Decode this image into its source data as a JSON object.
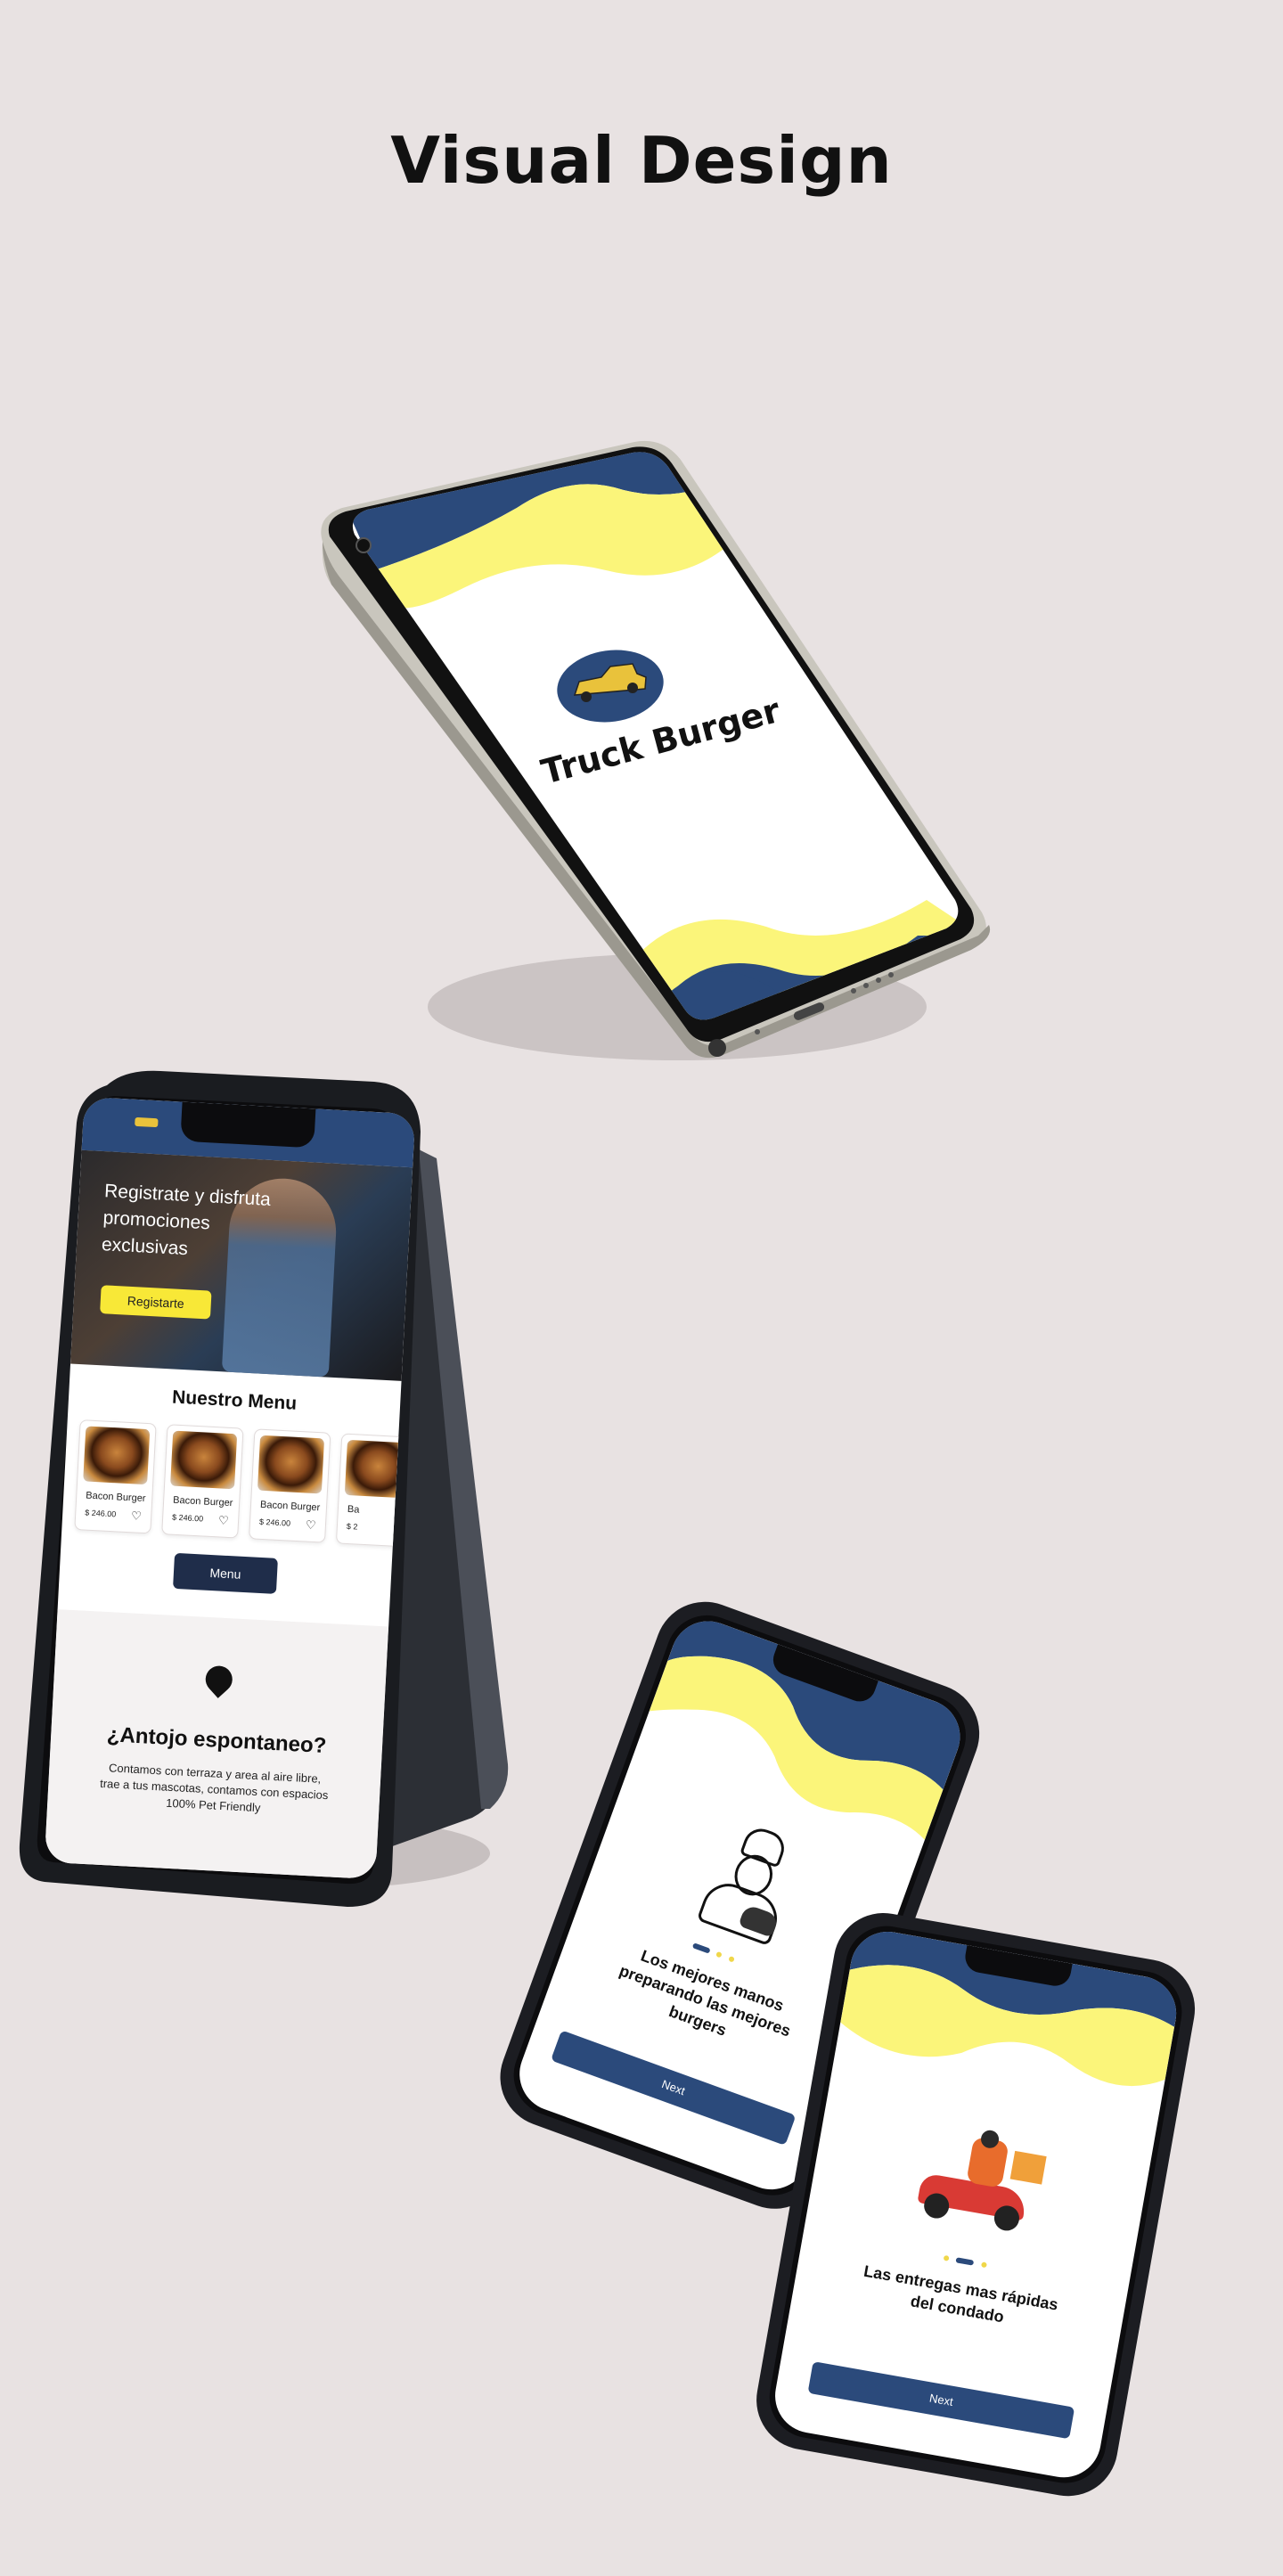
{
  "page": {
    "title": "Visual Design"
  },
  "splash": {
    "brand": "Truck Burger"
  },
  "home": {
    "hero_text": "Registrate y disfruta promociones exclusivas",
    "hero_button": "Registarte",
    "menu_title": "Nuestro Menu",
    "menu_items": [
      {
        "name": "Bacon Burger",
        "price": "$ 246.00"
      },
      {
        "name": "Bacon Burger",
        "price": "$ 246.00"
      },
      {
        "name": "Bacon Burger",
        "price": "$ 246.00"
      },
      {
        "name": "Ba",
        "price": "$ 2"
      }
    ],
    "menu_button": "Menu",
    "location_title": "¿Antojo espontaneo?",
    "location_text": "Contamos con terraza y area al aire libre, trae a tus mascotas, contamos con espacios 100% Pet Friendly"
  },
  "onboarding1": {
    "text": "Los mejores manos preparando las mejores burgers",
    "button": "Next"
  },
  "onboarding2": {
    "text": "Las entregas mas rápidas del condado",
    "button": "Next"
  },
  "colors": {
    "navy": "#2b4a7b",
    "yellow": "#fbf57a",
    "dark_button": "#1f2d4a",
    "background": "#e8e2e2"
  }
}
